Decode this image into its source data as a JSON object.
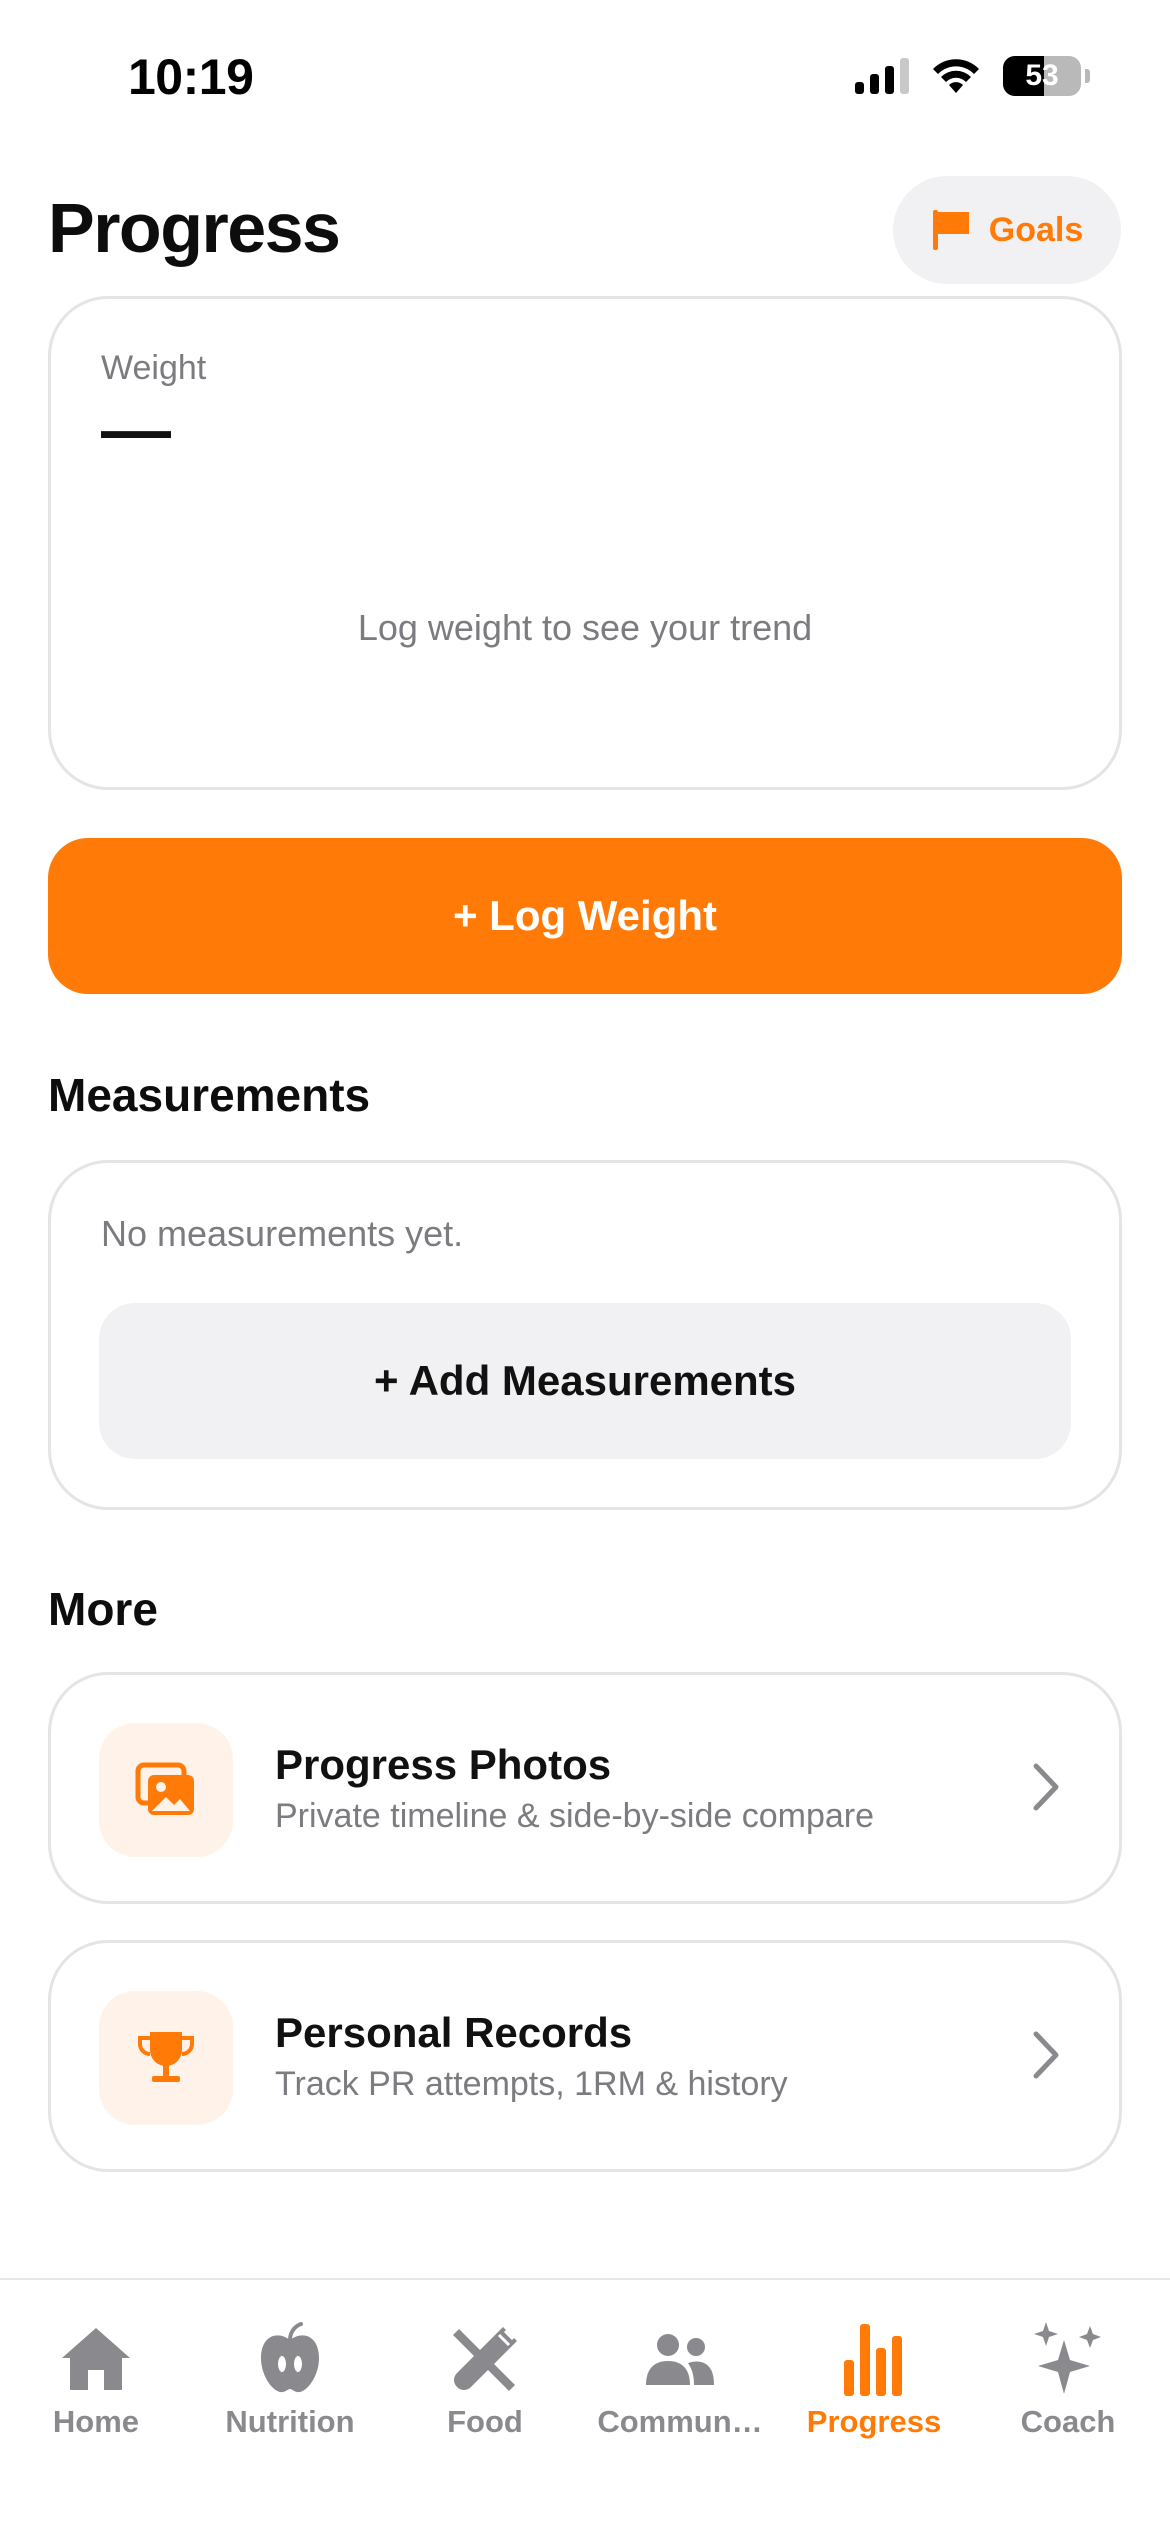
{
  "status_bar": {
    "time": "10:19",
    "battery": "53",
    "battery_level": 0.53
  },
  "header": {
    "title": "Progress",
    "goals_label": "Goals"
  },
  "weight_card": {
    "label": "Weight",
    "value": "—",
    "empty_text": "Log weight to see your trend"
  },
  "log_weight_label": "+ Log Weight",
  "measurements": {
    "title": "Measurements",
    "empty_text": "No measurements yet.",
    "add_label": "+ Add Measurements"
  },
  "more": {
    "title": "More",
    "items": [
      {
        "title": "Progress Photos",
        "subtitle": "Private timeline & side-by-side compare",
        "icon": "photos-icon"
      },
      {
        "title": "Personal Records",
        "subtitle": "Track PR attempts, 1RM & history",
        "icon": "trophy-icon"
      }
    ]
  },
  "tabs": [
    {
      "label": "Home",
      "icon": "house-icon",
      "active": false
    },
    {
      "label": "Nutrition",
      "icon": "apple-icon",
      "active": false
    },
    {
      "label": "Food",
      "icon": "fork-knife-icon",
      "active": false
    },
    {
      "label": "Commun…",
      "icon": "people-icon",
      "active": false
    },
    {
      "label": "Progress",
      "icon": "bar-chart-icon",
      "active": true
    },
    {
      "label": "Coach",
      "icon": "sparkles-icon",
      "active": false
    }
  ],
  "colors": {
    "accent": "#ff7a06",
    "muted": "#7b7b80",
    "tab_inactive": "#8a8a8e"
  }
}
